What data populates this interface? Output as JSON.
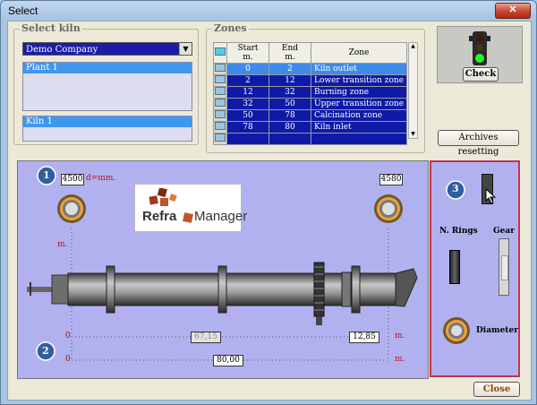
{
  "window": {
    "title": "Select",
    "close_icon": "x-icon"
  },
  "select_kiln": {
    "group_label": "Select kiln",
    "company": "Demo Company",
    "plant": "Plant 1",
    "kiln": "Kiln 1"
  },
  "zones": {
    "group_label": "Zones",
    "headers": {
      "start": "Start",
      "start_unit": "m.",
      "end": "End",
      "end_unit": "m.",
      "zone": "Zone"
    },
    "rows": [
      {
        "start": "0",
        "end": "2",
        "zone": "Kiln outlet"
      },
      {
        "start": "2",
        "end": "12",
        "zone": "Lower transition zone"
      },
      {
        "start": "12",
        "end": "32",
        "zone": "Burning zone"
      },
      {
        "start": "32",
        "end": "50",
        "zone": "Upper transition zone"
      },
      {
        "start": "50",
        "end": "78",
        "zone": "Calcination zone"
      },
      {
        "start": "78",
        "end": "80",
        "zone": "Kiln inlet"
      }
    ]
  },
  "check": {
    "button": "Check",
    "light": "green"
  },
  "archives_button": "Archives resetting",
  "kiln": {
    "step1": "1",
    "step2": "2",
    "step3": "3",
    "dia_left": "4500",
    "dia_unit": "d=mm.",
    "dia_right": "4580",
    "m_label": "m.",
    "zero": "0",
    "dist_mid": "67,15",
    "dist_right": "12,85",
    "length_total": "80,00",
    "logo_text_1": "Refra",
    "logo_text_2": "Manager"
  },
  "right_panel": {
    "n_rings": "N. Rings",
    "gear": "Gear",
    "diameter": "Diameter"
  },
  "close_button": "Close",
  "colors": {
    "selection": "#0e1aa6",
    "panel": "#b2b1f0",
    "accent_red": "#c0344f"
  }
}
